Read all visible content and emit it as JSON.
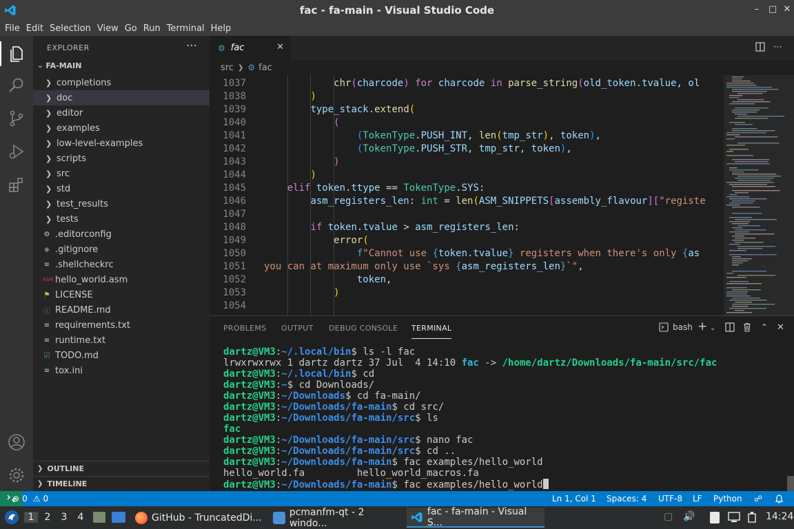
{
  "window": {
    "title": "fac - fa-main - Visual Studio Code",
    "minimize": "–",
    "maximize": "□",
    "close": "✕"
  },
  "menu": [
    "File",
    "Edit",
    "Selection",
    "View",
    "Go",
    "Run",
    "Terminal",
    "Help"
  ],
  "sidebar": {
    "header": "EXPLORER",
    "more": "⋯",
    "root": "FA-MAIN",
    "folders": [
      "completions",
      "doc",
      "editor",
      "examples",
      "low-level-examples",
      "scripts",
      "src",
      "std",
      "test_results",
      "tests"
    ],
    "files": [
      {
        "name": ".editorconfig",
        "icon": "⚙",
        "color": "#c5c5c5"
      },
      {
        "name": ".gitignore",
        "icon": "◆",
        "color": "#6d8086"
      },
      {
        "name": ".shellcheckrc",
        "icon": "≡",
        "color": "#c5c5c5"
      },
      {
        "name": "hello_world.asm",
        "icon": "ASM",
        "color": "#cc3e44"
      },
      {
        "name": "LICENSE",
        "icon": "⚑",
        "color": "#cbcb41"
      },
      {
        "name": "README.md",
        "icon": "ⓘ",
        "color": "#519aba"
      },
      {
        "name": "requirements.txt",
        "icon": "≡",
        "color": "#c5c5c5"
      },
      {
        "name": "runtime.txt",
        "icon": "≡",
        "color": "#c5c5c5"
      },
      {
        "name": "TODO.md",
        "icon": "☑",
        "color": "#519aba"
      },
      {
        "name": "tox.ini",
        "icon": "≡",
        "color": "#c5c5c5"
      }
    ],
    "outline": "OUTLINE",
    "timeline": "TIMELINE"
  },
  "editor": {
    "tab_label": "fac",
    "tab_close": "✕",
    "breadcrumb_folder": "src",
    "breadcrumb_file": "fac",
    "line_numbers": [
      "1037",
      "1038",
      "1039",
      "1040",
      "1041",
      "1042",
      "1043",
      "1044",
      "1045",
      "1046",
      "1047",
      "1048",
      "1049",
      "1050",
      "1051",
      "1052",
      "1053",
      "1054"
    ]
  },
  "panel": {
    "tabs": [
      "PROBLEMS",
      "OUTPUT",
      "DEBUG CONSOLE",
      "TERMINAL"
    ],
    "shell": "bash",
    "terminal": [
      {
        "user": "dartz@VM3",
        "path": "~/.local/bin",
        "cmd": " ls -l fac"
      },
      {
        "plain": "lrwxrwxrwx 1 dartz dartz 37 Jul  4 14:10 ",
        "link": "fac",
        "arrow": " -> ",
        "target": "/home/dartz/Downloads/fa-main/src/fac"
      },
      {
        "user": "dartz@VM3",
        "path": "~/.local/bin",
        "cmd": " cd"
      },
      {
        "user": "dartz@VM3",
        "path": "~",
        "cmd": " cd Downloads/"
      },
      {
        "user": "dartz@VM3",
        "path": "~/Downloads",
        "cmd": " cd fa-main/"
      },
      {
        "user": "dartz@VM3",
        "path": "~/Downloads/fa-main",
        "cmd": " cd src/"
      },
      {
        "user": "dartz@VM3",
        "path": "~/Downloads/fa-main/src",
        "cmd": " ls"
      },
      {
        "exec": "fac"
      },
      {
        "user": "dartz@VM3",
        "path": "~/Downloads/fa-main/src",
        "cmd": " nano fac"
      },
      {
        "user": "dartz@VM3",
        "path": "~/Downloads/fa-main/src",
        "cmd": " cd .."
      },
      {
        "user": "dartz@VM3",
        "path": "~/Downloads/fa-main",
        "cmd": " fac examples/hello_world"
      },
      {
        "plain": "hello_world.fa         hello_world_macros.fa"
      },
      {
        "user": "dartz@VM3",
        "path": "~/Downloads/fa-main",
        "cmd": " fac examples/hello_world",
        "cursor": true
      }
    ]
  },
  "statusbar": {
    "errors": "0",
    "warnings": "0",
    "position": "Ln 1, Col 1",
    "spaces": "Spaces: 4",
    "encoding": "UTF-8",
    "eol": "LF",
    "language": "Python"
  },
  "taskbar": {
    "workspaces": [
      "1",
      "2",
      "3",
      "4"
    ],
    "tasks": [
      {
        "label": "GitHub - TruncatedDi...",
        "color": "#ff7139"
      },
      {
        "label": "pcmanfm-qt - 2 windo...",
        "color": "#4a90d9"
      },
      {
        "label": "fac - fa-main - Visual S...",
        "color": "#0078d4"
      }
    ],
    "clock": "14:24"
  },
  "colors": {
    "accent": "#007acc",
    "activity_bar": "#333333",
    "sidebar": "#252526",
    "editor": "#1e1e1e",
    "prompt_green": "#23d18b",
    "prompt_blue": "#3b8eea"
  }
}
